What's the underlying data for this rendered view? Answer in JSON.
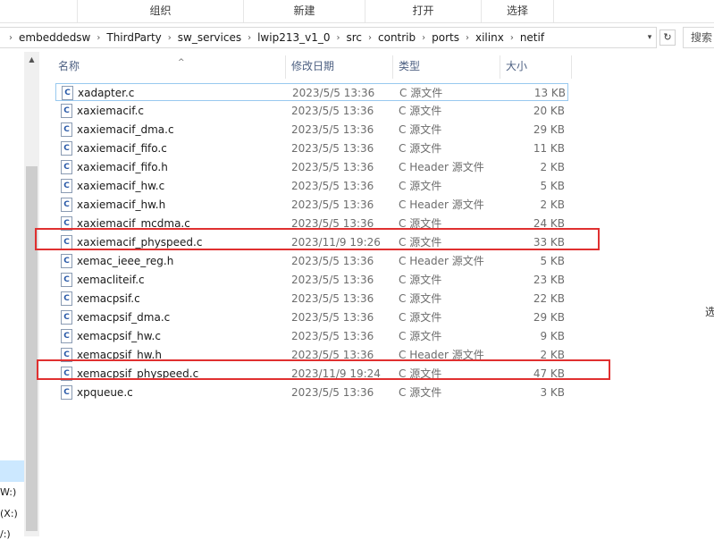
{
  "ribbon": {
    "groups": [
      "组织",
      "新建",
      "打开",
      "选择"
    ]
  },
  "address": {
    "crumbs": [
      "embeddedsw",
      "ThirdParty",
      "sw_services",
      "lwip213_v1_0",
      "src",
      "contrib",
      "ports",
      "xilinx",
      "netif"
    ],
    "search_placeholder": "搜索"
  },
  "nav": {
    "items": [
      "W:)",
      "(X:)",
      "/:)"
    ]
  },
  "columns": {
    "name": "名称",
    "date": "修改日期",
    "type": "类型",
    "size": "大小"
  },
  "files": [
    {
      "name": "xadapter.c",
      "date": "2023/5/5 13:36",
      "type": "C 源文件",
      "size": "13 KB"
    },
    {
      "name": "xaxiemacif.c",
      "date": "2023/5/5 13:36",
      "type": "C 源文件",
      "size": "20 KB"
    },
    {
      "name": "xaxiemacif_dma.c",
      "date": "2023/5/5 13:36",
      "type": "C 源文件",
      "size": "29 KB"
    },
    {
      "name": "xaxiemacif_fifo.c",
      "date": "2023/5/5 13:36",
      "type": "C 源文件",
      "size": "11 KB"
    },
    {
      "name": "xaxiemacif_fifo.h",
      "date": "2023/5/5 13:36",
      "type": "C Header 源文件",
      "size": "2 KB"
    },
    {
      "name": "xaxiemacif_hw.c",
      "date": "2023/5/5 13:36",
      "type": "C 源文件",
      "size": "5 KB"
    },
    {
      "name": "xaxiemacif_hw.h",
      "date": "2023/5/5 13:36",
      "type": "C Header 源文件",
      "size": "2 KB"
    },
    {
      "name": "xaxiemacif_mcdma.c",
      "date": "2023/5/5 13:36",
      "type": "C 源文件",
      "size": "24 KB"
    },
    {
      "name": "xaxiemacif_physpeed.c",
      "date": "2023/11/9 19:26",
      "type": "C 源文件",
      "size": "33 KB"
    },
    {
      "name": "xemac_ieee_reg.h",
      "date": "2023/5/5 13:36",
      "type": "C Header 源文件",
      "size": "5 KB"
    },
    {
      "name": "xemacliteif.c",
      "date": "2023/5/5 13:36",
      "type": "C 源文件",
      "size": "23 KB"
    },
    {
      "name": "xemacpsif.c",
      "date": "2023/5/5 13:36",
      "type": "C 源文件",
      "size": "22 KB"
    },
    {
      "name": "xemacpsif_dma.c",
      "date": "2023/5/5 13:36",
      "type": "C 源文件",
      "size": "29 KB"
    },
    {
      "name": "xemacpsif_hw.c",
      "date": "2023/5/5 13:36",
      "type": "C 源文件",
      "size": "9 KB"
    },
    {
      "name": "xemacpsif_hw.h",
      "date": "2023/5/5 13:36",
      "type": "C Header 源文件",
      "size": "2 KB"
    },
    {
      "name": "xemacpsif_physpeed.c",
      "date": "2023/11/9 19:24",
      "type": "C 源文件",
      "size": "47 KB"
    },
    {
      "name": "xpqueue.c",
      "date": "2023/5/5 13:36",
      "type": "C 源文件",
      "size": "3 KB"
    }
  ],
  "highlighted_rows": [
    8,
    15
  ],
  "highlight_color": "#e03030",
  "file_icon": "c-source-file-icon",
  "right_pane_text": "选"
}
